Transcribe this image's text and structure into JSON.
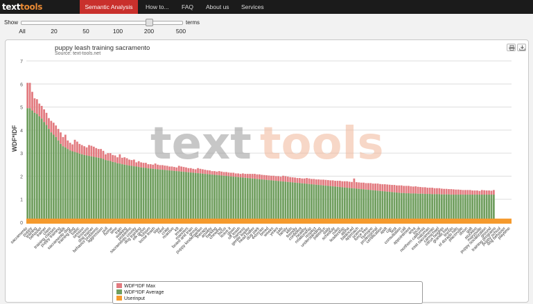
{
  "header": {
    "logo_text": "text",
    "logo_accent": "tools",
    "nav": [
      {
        "label": "Semantic Analysis",
        "active": true
      },
      {
        "label": "How to...",
        "active": false
      },
      {
        "label": "FAQ",
        "active": false
      },
      {
        "label": "About us",
        "active": false
      },
      {
        "label": "Services",
        "active": false
      }
    ]
  },
  "controls": {
    "show_label": "Show",
    "terms_label": "terms",
    "slider_ticks": [
      "All",
      "20",
      "50",
      "100",
      "200",
      "500"
    ],
    "selected": "200"
  },
  "chart_panel": {
    "print_icon": "printer-icon",
    "download_icon": "download-icon",
    "watermark_text": "text",
    "watermark_accent": "tools"
  },
  "chart_data": {
    "type": "bar",
    "title": "puppy leash training sacramento",
    "subtitle": "Source: text-tools.net",
    "ylabel": "WDF*IDF",
    "xlabel": "",
    "ylim": [
      0,
      7
    ],
    "yticks": [
      0,
      1,
      2,
      3,
      4,
      5,
      6,
      7
    ],
    "grid": true,
    "legend_position": "bottom",
    "colors": {
      "max": "#e27a7f",
      "average": "#6f9e5e",
      "userinput": "#f59a2d",
      "grid": "#dddddd"
    },
    "series": [
      {
        "name": "WDF*IDF Max",
        "stacked_on_average": true,
        "visible": true
      },
      {
        "name": "WDF*IDF Average"
      },
      {
        "name": "Userinput",
        "values_constant": 0.1
      }
    ],
    "categories": [
      "sacramento",
      "dog",
      "puppy",
      "leash",
      "training",
      "dogs",
      "behavior",
      "obedience",
      "trainer",
      "positive",
      "class",
      "pet",
      "training classes",
      "private",
      "puppy training",
      "classes",
      "walk",
      "reinforcement",
      "sacramento dog",
      "trainers",
      "training dog",
      "teach",
      "basic",
      "owners",
      "session",
      "program",
      "lessons",
      "skills",
      "dog trainer",
      "training sacramento",
      "behavior problems",
      "sessions",
      "aggression",
      "owner",
      "pull",
      "good",
      "home",
      "help",
      "time",
      "commands",
      "train",
      "learn",
      "walking",
      "certified",
      "problems",
      "service",
      "sacramento county",
      "puppy classes",
      "dog training",
      "rancho cordova",
      "elk grove",
      "roseville",
      "folsom",
      "davis",
      "loose leash",
      "sit",
      "stay",
      "come",
      "heel",
      "potty",
      "crate",
      "socialization",
      "reactive",
      "canine",
      "k9",
      "clicker",
      "treats",
      "reward",
      "manners",
      "board",
      "board and train",
      "in-home",
      "group",
      "private lessons",
      "puppy kindergarten",
      "agility",
      "therapy",
      "emotional",
      "anxiety",
      "jumping",
      "barking",
      "biting",
      "chewing",
      "recall",
      "focus",
      "attention",
      "leave it",
      "drop it",
      "down",
      "place",
      "off leash",
      "e-collar",
      "harness",
      "collar",
      "gentle leader",
      "prong",
      "head halter",
      "training tips",
      "dog park",
      "walks",
      "exercise",
      "energy",
      "breed",
      "age",
      "weeks",
      "months",
      "years",
      "vaccinations",
      "safe",
      "environment",
      "family",
      "children",
      "kids",
      "people",
      "friendly",
      "calm",
      "confident",
      "happy",
      "healthy",
      "love",
      "relationship",
      "trust",
      "respect",
      "communication",
      "understanding",
      "consistent",
      "patience",
      "practice",
      "daily",
      "routine",
      "schedule",
      "structure",
      "rules",
      "boundaries",
      "leadership",
      "pack",
      "alpha",
      "dominance",
      "balanced",
      "methods",
      "approach",
      "techniques",
      "science",
      "based",
      "force free",
      "fear free",
      "humane",
      "modern",
      "professional",
      "experience",
      "certification",
      "ccpdt",
      "apdt",
      "akc",
      "cgc",
      "canine good citizen",
      "test",
      "evaluation",
      "consultation",
      "free",
      "call",
      "contact",
      "appointment",
      "location",
      "area",
      "near",
      "local",
      "serving",
      "northern california",
      "west sacramento",
      "natomas",
      "midtown",
      "east sacramento",
      "land park",
      "carmichael",
      "fair oaks",
      "citrus heights",
      "orangevale",
      "granite bay",
      "rocklin",
      "lincoln",
      "auburn",
      "el dorado hills",
      "cameron park",
      "placerville",
      "woodland",
      "dixon",
      "vacaville",
      "galt",
      "lodi",
      "stockton",
      "yuba city",
      "marysville",
      "group classes",
      "puppy socialization",
      "well behaved",
      "ground",
      "behavioral issues",
      "training programs",
      "basic obedience",
      "puppy school",
      "adult dogs",
      "dog behavior",
      "new puppy",
      "playtime"
    ],
    "max_values": [
      6.05,
      6.05,
      5.66,
      5.38,
      5.34,
      5.15,
      5.05,
      4.9,
      4.75,
      4.52,
      4.4,
      4.32,
      4.2,
      4.05,
      3.9,
      3.7,
      3.8,
      3.55,
      3.45,
      3.38,
      3.58,
      3.5,
      3.4,
      3.35,
      3.3,
      3.25,
      3.35,
      3.32,
      3.28,
      3.22,
      3.18,
      3.18,
      3.1,
      2.95,
      3.0,
      3.0,
      2.92,
      2.9,
      2.82,
      2.95,
      2.8,
      2.82,
      2.78,
      2.72,
      2.7,
      2.72,
      2.6,
      2.65,
      2.6,
      2.58,
      2.58,
      2.52,
      2.52,
      2.5,
      2.55,
      2.5,
      2.48,
      2.48,
      2.46,
      2.45,
      2.42,
      2.42,
      2.4,
      2.38,
      2.45,
      2.42,
      2.4,
      2.38,
      2.35,
      2.35,
      2.32,
      2.3,
      2.35,
      2.32,
      2.3,
      2.28,
      2.26,
      2.25,
      2.22,
      2.22,
      2.2,
      2.22,
      2.2,
      2.18,
      2.18,
      2.16,
      2.15,
      2.15,
      2.12,
      2.12,
      2.1,
      2.12,
      2.1,
      2.1,
      2.1,
      2.1,
      2.1,
      2.08,
      2.08,
      2.06,
      2.05,
      2.04,
      2.03,
      2.02,
      2.02,
      2.0,
      2.0,
      1.98,
      2.02,
      2.0,
      1.98,
      1.96,
      1.95,
      1.94,
      1.92,
      1.92,
      1.9,
      1.9,
      1.92,
      1.9,
      1.88,
      1.88,
      1.86,
      1.86,
      1.85,
      1.85,
      1.84,
      1.83,
      1.82,
      1.82,
      1.8,
      1.8,
      1.8,
      1.78,
      1.78,
      1.78,
      1.76,
      1.75,
      1.9,
      1.74,
      1.73,
      1.72,
      1.72,
      1.7,
      1.7,
      1.7,
      1.68,
      1.68,
      1.68,
      1.66,
      1.65,
      1.65,
      1.64,
      1.63,
      1.62,
      1.62,
      1.6,
      1.6,
      1.6,
      1.58,
      1.58,
      1.58,
      1.56,
      1.55,
      1.56,
      1.54,
      1.53,
      1.52,
      1.52,
      1.5,
      1.5,
      1.5,
      1.48,
      1.48,
      1.48,
      1.46,
      1.45,
      1.45,
      1.44,
      1.44,
      1.43,
      1.42,
      1.42,
      1.41,
      1.4,
      1.4,
      1.4,
      1.4,
      1.38,
      1.38,
      1.38,
      1.36,
      1.4,
      1.39,
      1.38,
      1.38,
      1.37,
      1.4,
      1.36,
      1.35,
      1.38,
      1.42,
      1.4,
      1.45
    ],
    "avg_values": [
      4.95,
      4.95,
      4.85,
      4.75,
      4.7,
      4.6,
      4.5,
      4.35,
      4.22,
      4.05,
      3.9,
      3.8,
      3.7,
      3.55,
      3.4,
      3.3,
      3.25,
      3.18,
      3.12,
      3.08,
      3.05,
      3.02,
      2.98,
      2.95,
      2.92,
      2.9,
      2.88,
      2.86,
      2.84,
      2.82,
      2.8,
      2.78,
      2.75,
      2.7,
      2.68,
      2.66,
      2.62,
      2.6,
      2.56,
      2.55,
      2.52,
      2.5,
      2.48,
      2.46,
      2.45,
      2.43,
      2.42,
      2.4,
      2.38,
      2.37,
      2.36,
      2.34,
      2.33,
      2.32,
      2.31,
      2.3,
      2.29,
      2.28,
      2.27,
      2.26,
      2.25,
      2.24,
      2.23,
      2.22,
      2.21,
      2.2,
      2.19,
      2.18,
      2.17,
      2.16,
      2.15,
      2.14,
      2.13,
      2.12,
      2.11,
      2.1,
      2.09,
      2.08,
      2.07,
      2.06,
      2.05,
      2.04,
      2.03,
      2.02,
      2.01,
      2.0,
      1.99,
      1.98,
      1.97,
      1.96,
      1.95,
      1.94,
      1.93,
      1.92,
      1.91,
      1.9,
      1.89,
      1.88,
      1.87,
      1.86,
      1.85,
      1.84,
      1.83,
      1.82,
      1.81,
      1.8,
      1.79,
      1.78,
      1.77,
      1.76,
      1.75,
      1.74,
      1.73,
      1.72,
      1.71,
      1.7,
      1.69,
      1.68,
      1.67,
      1.66,
      1.65,
      1.64,
      1.63,
      1.62,
      1.61,
      1.6,
      1.59,
      1.58,
      1.57,
      1.56,
      1.55,
      1.54,
      1.53,
      1.52,
      1.51,
      1.5,
      1.49,
      1.48,
      1.47,
      1.46,
      1.45,
      1.44,
      1.43,
      1.42,
      1.41,
      1.4,
      1.39,
      1.38,
      1.37,
      1.36,
      1.35,
      1.34,
      1.33,
      1.32,
      1.31,
      1.3,
      1.29,
      1.28,
      1.27,
      1.27,
      1.26,
      1.26,
      1.25,
      1.25,
      1.25,
      1.24,
      1.24,
      1.24,
      1.23,
      1.23,
      1.23,
      1.22,
      1.22,
      1.22,
      1.22,
      1.21,
      1.21,
      1.21,
      1.21,
      1.2,
      1.2,
      1.2,
      1.2,
      1.2,
      1.2,
      1.2,
      1.2,
      1.2,
      1.2,
      1.2,
      1.2,
      1.2,
      1.2,
      1.2,
      1.2,
      1.2,
      1.2,
      1.2
    ]
  }
}
